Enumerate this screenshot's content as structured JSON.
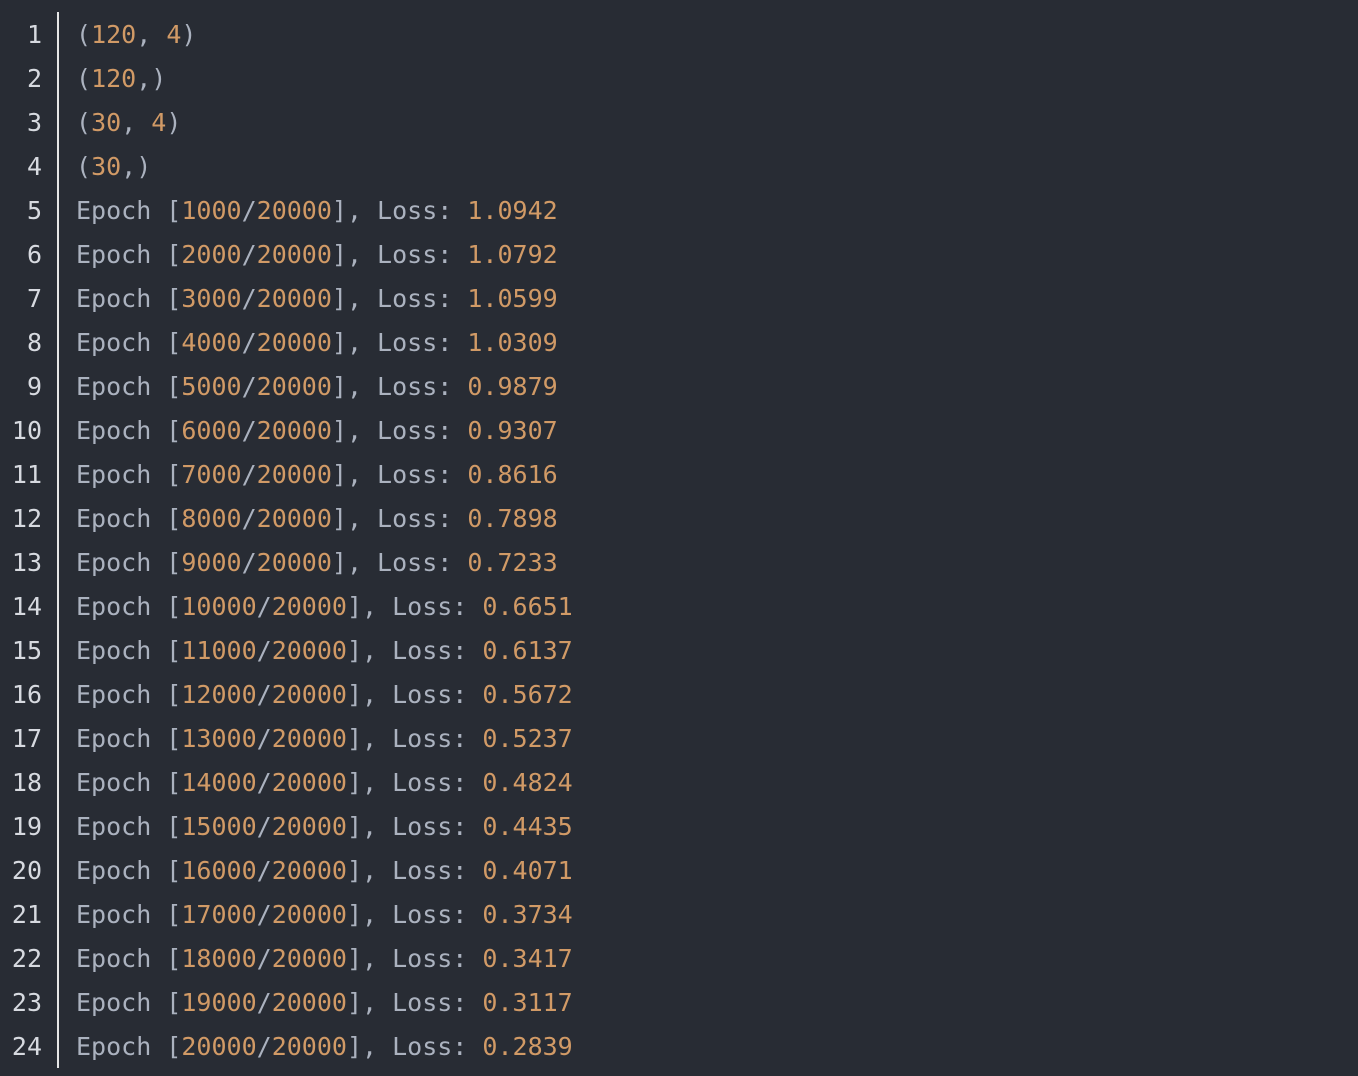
{
  "colors": {
    "background": "#282c34",
    "text": "#abb2bf",
    "number": "#d19a66",
    "line_number": "#d7dae0",
    "gutter_rule": "#e6e6e6"
  },
  "lines": [
    {
      "n": "1",
      "tokens": [
        {
          "t": "(",
          "k": "p"
        },
        {
          "t": "120",
          "k": "num"
        },
        {
          "t": ", ",
          "k": "p"
        },
        {
          "t": "4",
          "k": "num"
        },
        {
          "t": ")",
          "k": "p"
        }
      ]
    },
    {
      "n": "2",
      "tokens": [
        {
          "t": "(",
          "k": "p"
        },
        {
          "t": "120",
          "k": "num"
        },
        {
          "t": ",)",
          "k": "p"
        }
      ]
    },
    {
      "n": "3",
      "tokens": [
        {
          "t": "(",
          "k": "p"
        },
        {
          "t": "30",
          "k": "num"
        },
        {
          "t": ", ",
          "k": "p"
        },
        {
          "t": "4",
          "k": "num"
        },
        {
          "t": ")",
          "k": "p"
        }
      ]
    },
    {
      "n": "4",
      "tokens": [
        {
          "t": "(",
          "k": "p"
        },
        {
          "t": "30",
          "k": "num"
        },
        {
          "t": ",)",
          "k": "p"
        }
      ]
    },
    {
      "n": "5",
      "tokens": [
        {
          "t": "Epoch [",
          "k": "p"
        },
        {
          "t": "1000",
          "k": "num"
        },
        {
          "t": "/",
          "k": "p"
        },
        {
          "t": "20000",
          "k": "num"
        },
        {
          "t": "], Loss: ",
          "k": "p"
        },
        {
          "t": "1.0942",
          "k": "num"
        }
      ]
    },
    {
      "n": "6",
      "tokens": [
        {
          "t": "Epoch [",
          "k": "p"
        },
        {
          "t": "2000",
          "k": "num"
        },
        {
          "t": "/",
          "k": "p"
        },
        {
          "t": "20000",
          "k": "num"
        },
        {
          "t": "], Loss: ",
          "k": "p"
        },
        {
          "t": "1.0792",
          "k": "num"
        }
      ]
    },
    {
      "n": "7",
      "tokens": [
        {
          "t": "Epoch [",
          "k": "p"
        },
        {
          "t": "3000",
          "k": "num"
        },
        {
          "t": "/",
          "k": "p"
        },
        {
          "t": "20000",
          "k": "num"
        },
        {
          "t": "], Loss: ",
          "k": "p"
        },
        {
          "t": "1.0599",
          "k": "num"
        }
      ]
    },
    {
      "n": "8",
      "tokens": [
        {
          "t": "Epoch [",
          "k": "p"
        },
        {
          "t": "4000",
          "k": "num"
        },
        {
          "t": "/",
          "k": "p"
        },
        {
          "t": "20000",
          "k": "num"
        },
        {
          "t": "], Loss: ",
          "k": "p"
        },
        {
          "t": "1.0309",
          "k": "num"
        }
      ]
    },
    {
      "n": "9",
      "tokens": [
        {
          "t": "Epoch [",
          "k": "p"
        },
        {
          "t": "5000",
          "k": "num"
        },
        {
          "t": "/",
          "k": "p"
        },
        {
          "t": "20000",
          "k": "num"
        },
        {
          "t": "], Loss: ",
          "k": "p"
        },
        {
          "t": "0.9879",
          "k": "num"
        }
      ]
    },
    {
      "n": "10",
      "tokens": [
        {
          "t": "Epoch [",
          "k": "p"
        },
        {
          "t": "6000",
          "k": "num"
        },
        {
          "t": "/",
          "k": "p"
        },
        {
          "t": "20000",
          "k": "num"
        },
        {
          "t": "], Loss: ",
          "k": "p"
        },
        {
          "t": "0.9307",
          "k": "num"
        }
      ]
    },
    {
      "n": "11",
      "tokens": [
        {
          "t": "Epoch [",
          "k": "p"
        },
        {
          "t": "7000",
          "k": "num"
        },
        {
          "t": "/",
          "k": "p"
        },
        {
          "t": "20000",
          "k": "num"
        },
        {
          "t": "], Loss: ",
          "k": "p"
        },
        {
          "t": "0.8616",
          "k": "num"
        }
      ]
    },
    {
      "n": "12",
      "tokens": [
        {
          "t": "Epoch [",
          "k": "p"
        },
        {
          "t": "8000",
          "k": "num"
        },
        {
          "t": "/",
          "k": "p"
        },
        {
          "t": "20000",
          "k": "num"
        },
        {
          "t": "], Loss: ",
          "k": "p"
        },
        {
          "t": "0.7898",
          "k": "num"
        }
      ]
    },
    {
      "n": "13",
      "tokens": [
        {
          "t": "Epoch [",
          "k": "p"
        },
        {
          "t": "9000",
          "k": "num"
        },
        {
          "t": "/",
          "k": "p"
        },
        {
          "t": "20000",
          "k": "num"
        },
        {
          "t": "], Loss: ",
          "k": "p"
        },
        {
          "t": "0.7233",
          "k": "num"
        }
      ]
    },
    {
      "n": "14",
      "tokens": [
        {
          "t": "Epoch [",
          "k": "p"
        },
        {
          "t": "10000",
          "k": "num"
        },
        {
          "t": "/",
          "k": "p"
        },
        {
          "t": "20000",
          "k": "num"
        },
        {
          "t": "], Loss: ",
          "k": "p"
        },
        {
          "t": "0.6651",
          "k": "num"
        }
      ]
    },
    {
      "n": "15",
      "tokens": [
        {
          "t": "Epoch [",
          "k": "p"
        },
        {
          "t": "11000",
          "k": "num"
        },
        {
          "t": "/",
          "k": "p"
        },
        {
          "t": "20000",
          "k": "num"
        },
        {
          "t": "], Loss: ",
          "k": "p"
        },
        {
          "t": "0.6137",
          "k": "num"
        }
      ]
    },
    {
      "n": "16",
      "tokens": [
        {
          "t": "Epoch [",
          "k": "p"
        },
        {
          "t": "12000",
          "k": "num"
        },
        {
          "t": "/",
          "k": "p"
        },
        {
          "t": "20000",
          "k": "num"
        },
        {
          "t": "], Loss: ",
          "k": "p"
        },
        {
          "t": "0.5672",
          "k": "num"
        }
      ]
    },
    {
      "n": "17",
      "tokens": [
        {
          "t": "Epoch [",
          "k": "p"
        },
        {
          "t": "13000",
          "k": "num"
        },
        {
          "t": "/",
          "k": "p"
        },
        {
          "t": "20000",
          "k": "num"
        },
        {
          "t": "], Loss: ",
          "k": "p"
        },
        {
          "t": "0.5237",
          "k": "num"
        }
      ]
    },
    {
      "n": "18",
      "tokens": [
        {
          "t": "Epoch [",
          "k": "p"
        },
        {
          "t": "14000",
          "k": "num"
        },
        {
          "t": "/",
          "k": "p"
        },
        {
          "t": "20000",
          "k": "num"
        },
        {
          "t": "], Loss: ",
          "k": "p"
        },
        {
          "t": "0.4824",
          "k": "num"
        }
      ]
    },
    {
      "n": "19",
      "tokens": [
        {
          "t": "Epoch [",
          "k": "p"
        },
        {
          "t": "15000",
          "k": "num"
        },
        {
          "t": "/",
          "k": "p"
        },
        {
          "t": "20000",
          "k": "num"
        },
        {
          "t": "], Loss: ",
          "k": "p"
        },
        {
          "t": "0.4435",
          "k": "num"
        }
      ]
    },
    {
      "n": "20",
      "tokens": [
        {
          "t": "Epoch [",
          "k": "p"
        },
        {
          "t": "16000",
          "k": "num"
        },
        {
          "t": "/",
          "k": "p"
        },
        {
          "t": "20000",
          "k": "num"
        },
        {
          "t": "], Loss: ",
          "k": "p"
        },
        {
          "t": "0.4071",
          "k": "num"
        }
      ]
    },
    {
      "n": "21",
      "tokens": [
        {
          "t": "Epoch [",
          "k": "p"
        },
        {
          "t": "17000",
          "k": "num"
        },
        {
          "t": "/",
          "k": "p"
        },
        {
          "t": "20000",
          "k": "num"
        },
        {
          "t": "], Loss: ",
          "k": "p"
        },
        {
          "t": "0.3734",
          "k": "num"
        }
      ]
    },
    {
      "n": "22",
      "tokens": [
        {
          "t": "Epoch [",
          "k": "p"
        },
        {
          "t": "18000",
          "k": "num"
        },
        {
          "t": "/",
          "k": "p"
        },
        {
          "t": "20000",
          "k": "num"
        },
        {
          "t": "], Loss: ",
          "k": "p"
        },
        {
          "t": "0.3417",
          "k": "num"
        }
      ]
    },
    {
      "n": "23",
      "tokens": [
        {
          "t": "Epoch [",
          "k": "p"
        },
        {
          "t": "19000",
          "k": "num"
        },
        {
          "t": "/",
          "k": "p"
        },
        {
          "t": "20000",
          "k": "num"
        },
        {
          "t": "], Loss: ",
          "k": "p"
        },
        {
          "t": "0.3117",
          "k": "num"
        }
      ]
    },
    {
      "n": "24",
      "tokens": [
        {
          "t": "Epoch [",
          "k": "p"
        },
        {
          "t": "20000",
          "k": "num"
        },
        {
          "t": "/",
          "k": "p"
        },
        {
          "t": "20000",
          "k": "num"
        },
        {
          "t": "], Loss: ",
          "k": "p"
        },
        {
          "t": "0.2839",
          "k": "num"
        }
      ]
    }
  ]
}
